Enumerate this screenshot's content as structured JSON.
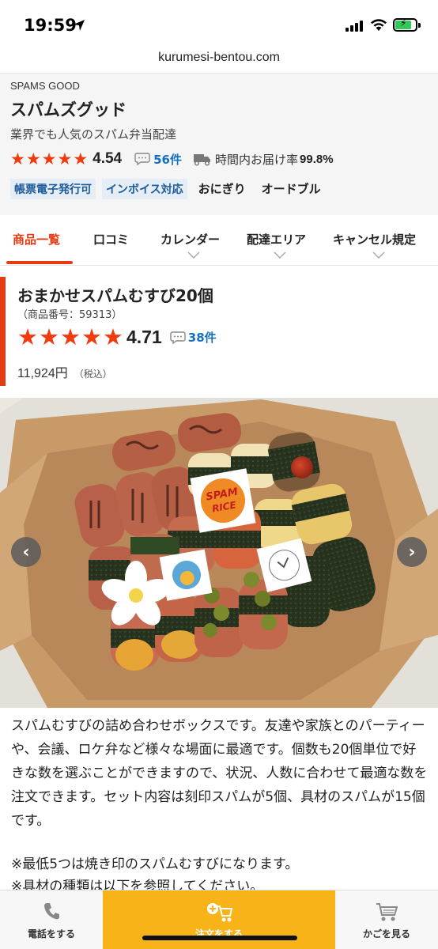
{
  "status_bar": {
    "time": "19:59"
  },
  "browser": {
    "url": "kurumesi-bentou.com"
  },
  "shop": {
    "brand": "SPAMS GOOD",
    "name": "スパムズグッド",
    "description": "業界でも人気のスパム弁当配達",
    "rating": "4.54",
    "review_count": "56件",
    "delivery_label": "時間内お届け率",
    "delivery_rate": "99.8%",
    "tags": [
      "帳票電子発行可",
      "インボイス対応",
      "おにぎり",
      "オードブル"
    ]
  },
  "tabs": [
    "商品一覧",
    "口コミ",
    "カレンダー",
    "配達エリア",
    "キャンセル規定"
  ],
  "product": {
    "title": "おまかせスパムむすび20個",
    "number": "（商品番号：59313）",
    "rating": "4.71",
    "review_count": "38件",
    "price": "11,924円",
    "tax": "（税込）"
  },
  "photo": {
    "sticker_1_line1": "SPAM",
    "sticker_1_line2": "RICE"
  },
  "description": {
    "paragraph": "スパムむすびの詰め合わせボックスです。友達や家族とのパーティーや、会議、ロケ弁など様々な場面に最適です。個数も20個単位で好きな数を選ぶことができますので、状況、人数に合わせて最適な数を注文できます。セット内容は刻印スパムが5個、具材のスパムが15個です。",
    "note_1": "※最低5つは焼き印のスパムむすびになります。",
    "note_2": "※具材の種類は以下を参照してください。"
  },
  "bottom_bar": {
    "call_label": "電話をする",
    "order_label": "注文をする",
    "cart_label": "かごを見る"
  },
  "colors": {
    "accent": "#e53c14",
    "star": "#f23a0f",
    "link": "#1570c0",
    "order": "#f7b318"
  }
}
